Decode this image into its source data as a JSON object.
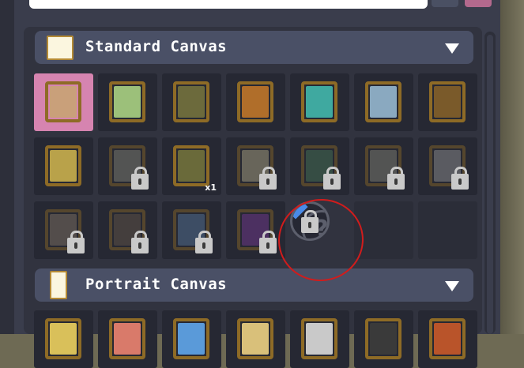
{
  "categories": [
    {
      "title": "Standard Canvas",
      "tiles": [
        {
          "state": "selected",
          "color": "#c9a07a"
        },
        {
          "state": "unlocked",
          "color": "#9cc07a"
        },
        {
          "state": "unlocked",
          "color": "#6c6a3c"
        },
        {
          "state": "unlocked",
          "color": "#b06e2a"
        },
        {
          "state": "unlocked",
          "color": "#3fa9a0"
        },
        {
          "state": "unlocked",
          "color": "#8aa9c0"
        },
        {
          "state": "unlocked",
          "color": "#7a5a2a"
        },
        {
          "state": "unlocked",
          "color": "#b9a24a"
        },
        {
          "state": "locked",
          "color": "#8a8a7a"
        },
        {
          "state": "unlocked",
          "color": "#6a6a3a",
          "count": "x1"
        },
        {
          "state": "locked",
          "color": "#b9b08a"
        },
        {
          "state": "locked",
          "color": "#4a7a5a"
        },
        {
          "state": "locked",
          "color": "#8a8a7a"
        },
        {
          "state": "locked",
          "color": "#9a9a9a"
        },
        {
          "state": "locked",
          "color": "#8a7a6a"
        },
        {
          "state": "locked",
          "color": "#6a5a4a"
        },
        {
          "state": "locked",
          "color": "#5a7aa0"
        },
        {
          "state": "locked",
          "color": "#7a3a9a"
        },
        {
          "state": "mystery",
          "mark": "?"
        },
        {
          "state": "empty"
        },
        {
          "state": "empty"
        }
      ]
    },
    {
      "title": "Portrait Canvas",
      "tiles": [
        {
          "state": "unlocked",
          "color": "#d9c05a"
        },
        {
          "state": "unlocked",
          "color": "#d97a6a"
        },
        {
          "state": "unlocked",
          "color": "#5a9ad9"
        },
        {
          "state": "unlocked",
          "color": "#d9c07a"
        },
        {
          "state": "unlocked",
          "color": "#c9c9c9"
        },
        {
          "state": "unlocked",
          "color": "#3a3a3a"
        },
        {
          "state": "unlocked",
          "color": "#b9542a"
        }
      ]
    }
  ],
  "icons": {
    "lock": "lock-icon",
    "arrow": "chevron-down-icon",
    "canvas": "canvas-icon",
    "mystery": "question-mark-icon"
  },
  "colors": {
    "panel": "#3a3d4c",
    "header": "#4a5066",
    "selected": "#d684b0",
    "annotation": "#d11c1c"
  }
}
